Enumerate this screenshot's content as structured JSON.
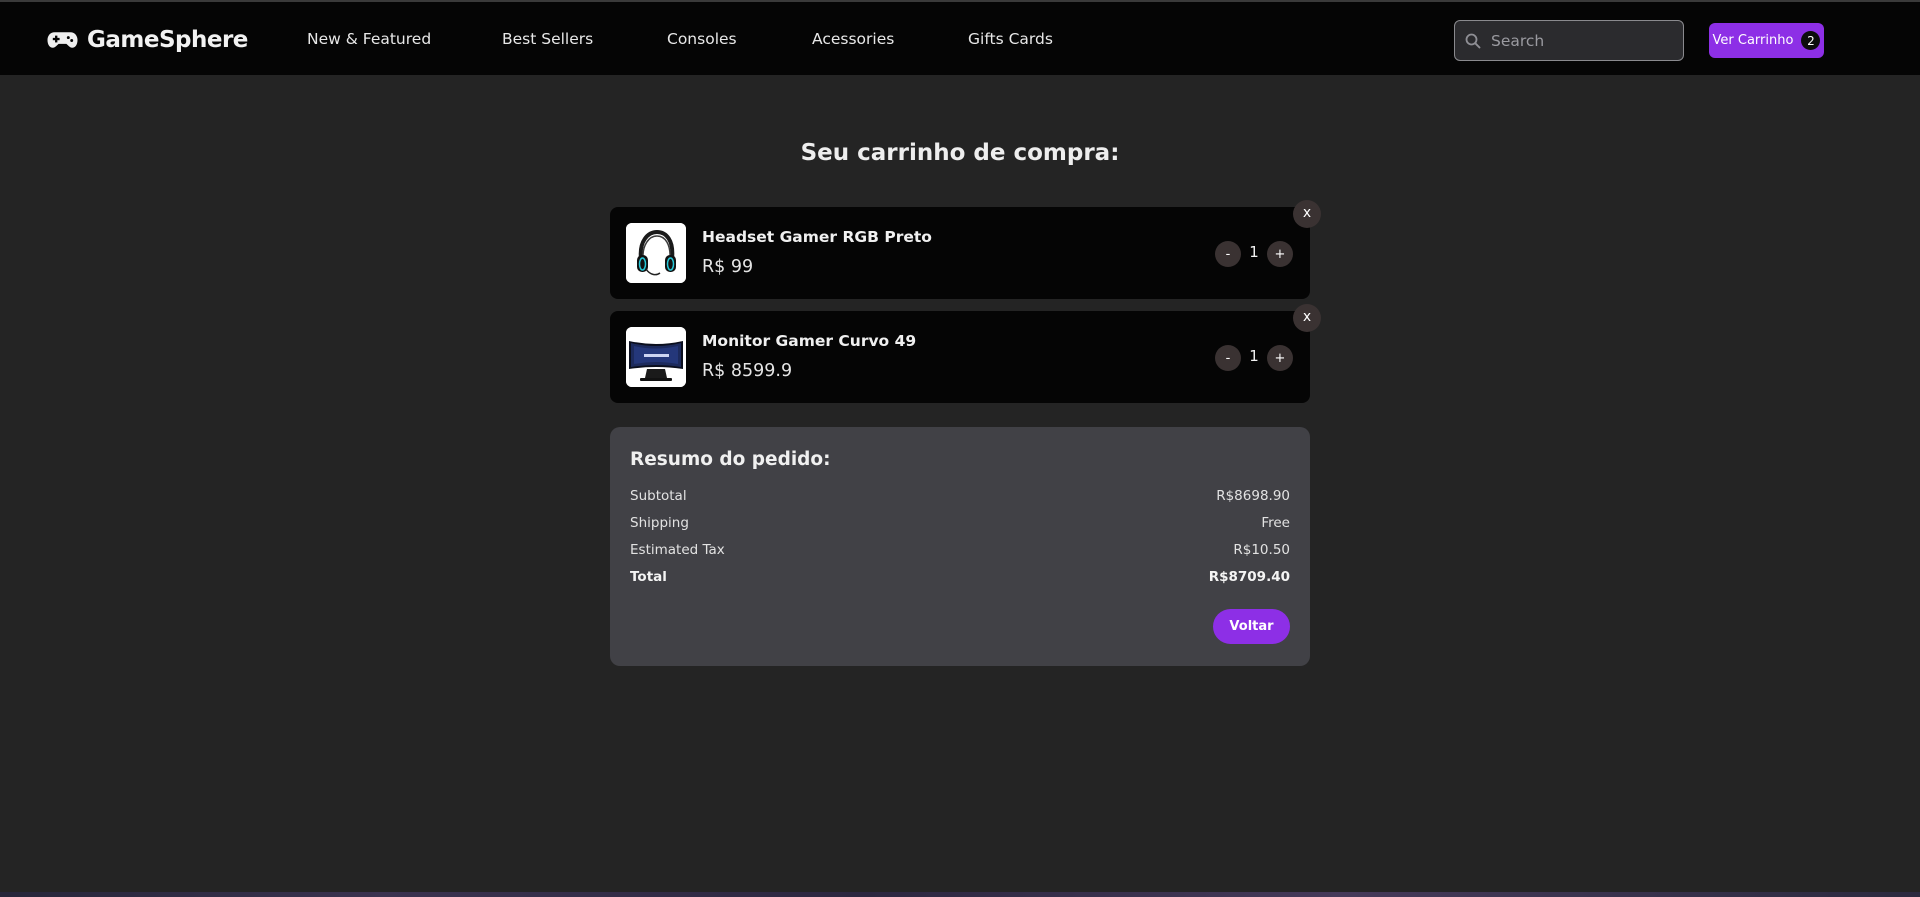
{
  "header": {
    "brand_name": "GameSphere",
    "brand_icon": "gamepad-icon",
    "nav": [
      {
        "label": "New & Featured"
      },
      {
        "label": "Best Sellers"
      },
      {
        "label": "Consoles"
      },
      {
        "label": "Acessories"
      },
      {
        "label": "Gifts Cards"
      }
    ],
    "search": {
      "placeholder": "Search",
      "value": "",
      "icon": "search-icon"
    },
    "cart_button": {
      "label": "Ver Carrinho",
      "count": "2"
    }
  },
  "main": {
    "title": "Seu carrinho de compra:",
    "items": [
      {
        "name": "Headset Gamer RGB Preto",
        "price": "R$ 99",
        "quantity": "1",
        "minus_label": "-",
        "plus_label": "+",
        "remove_label": "x",
        "image": "headset-image"
      },
      {
        "name": "Monitor Gamer Curvo 49",
        "price": "R$ 8599.9",
        "quantity": "1",
        "minus_label": "-",
        "plus_label": "+",
        "remove_label": "x",
        "image": "curved-monitor-image"
      }
    ]
  },
  "summary": {
    "title": "Resumo do pedido:",
    "rows": [
      {
        "label": "Subtotal",
        "value": "R$8698.90"
      },
      {
        "label": "Shipping",
        "value": "Free"
      },
      {
        "label": "Estimated Tax",
        "value": "R$10.50"
      },
      {
        "label": "Total",
        "value": "R$8709.40"
      }
    ],
    "back_button": "Voltar"
  },
  "colors": {
    "accent": "#8d2fe6",
    "background": "#242424",
    "navbar": "#050505",
    "summary_panel": "#414146"
  }
}
